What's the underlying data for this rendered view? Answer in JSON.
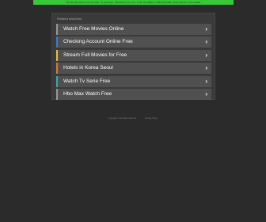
{
  "banner": {
    "text": "The domain was.com is for sale. To purchase, call Afternic.com at +1 781-373-6847 or 855-201-2286. Click here for more details."
  },
  "panel": {
    "heading": "Related searches",
    "items": [
      {
        "label": "Watch Free Movies Online",
        "chevron": "›",
        "accent": "#999999"
      },
      {
        "label": "Checking Account Online Free",
        "chevron": "›",
        "accent": "#3a7bd5"
      },
      {
        "label": "Stream Full Movies for Free",
        "chevron": "›",
        "accent": "#e8c23a"
      },
      {
        "label": "Hotels in Korea Seoul",
        "chevron": "›",
        "accent": "#e07a2b"
      },
      {
        "label": "Watch Tv Serie Free",
        "chevron": "›",
        "accent": "#3aa8b0"
      },
      {
        "label": "Hbo Max Watch Free",
        "chevron": "›",
        "accent": "#999999"
      }
    ]
  },
  "footer": {
    "copyright": "Copyright © All rights reserved.",
    "privacy": "Privacy Policy"
  },
  "colors": {
    "background": "#2b2b2b",
    "banner": "#37c837",
    "panel": "#3a3a3a",
    "item": "#505050"
  }
}
